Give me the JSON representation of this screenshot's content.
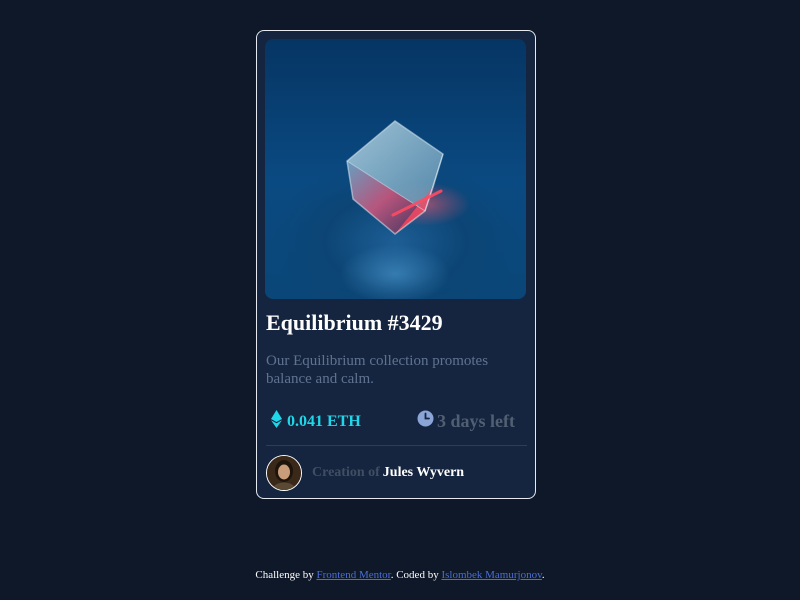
{
  "card": {
    "image": "equilibrium-cube-image",
    "title": "Equilibrium #3429",
    "description": "Our Equilibrium collection promotes balance and calm.",
    "price": {
      "icon": "ethereum-icon",
      "value": "0.041 ETH",
      "color": "#1fd7e8"
    },
    "time": {
      "icon": "clock-icon",
      "value": "3 days left"
    },
    "creator": {
      "avatar": "creator-avatar",
      "prefix": "Creation of",
      "name": "Jules Wyvern"
    }
  },
  "footer": {
    "text_1": "Challenge by ",
    "link_1": "Frontend Mentor",
    "text_2": ". Coded by ",
    "link_2": "Islombek Mamurjonov",
    "text_3": "."
  },
  "colors": {
    "background": "#0e1829",
    "card": "#15253f",
    "accent": "#1fd7e8",
    "link": "#4a6ed2"
  }
}
